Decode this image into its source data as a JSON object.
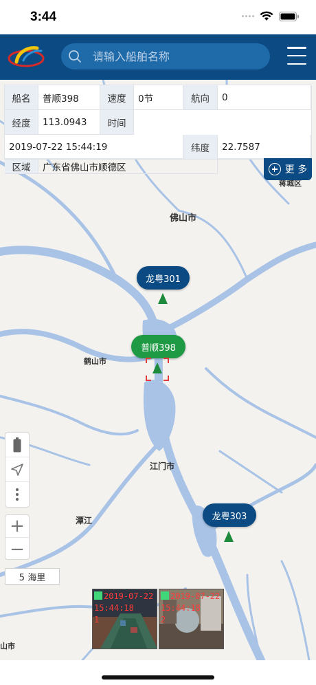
{
  "status_bar": {
    "time": "3:44"
  },
  "header": {
    "search_placeholder": "请输入船舶名称",
    "search_icon": "search-icon",
    "menu_icon": "hamburger-menu-icon"
  },
  "info": {
    "name_label": "船名",
    "name_value": "普顺398",
    "speed_label": "速度",
    "speed_value": "0节",
    "heading_label": "航向",
    "heading_value": "0",
    "lon_label": "经度",
    "lon_value": "113.0943",
    "time_label": "时间",
    "time_value": "2019-07-22 15:44:19",
    "lat_label": "纬度",
    "lat_value": "22.7587",
    "region_label": "区域",
    "region_value": "广东省佛山市顺德区"
  },
  "more_button": {
    "label": "更 多"
  },
  "map": {
    "cities": {
      "foshan": "佛山市",
      "heshan": "鹤山市",
      "jiangmen": "江门市",
      "tanjiang": "潭江",
      "fragment_right": "蒋城区",
      "fragment_bottom": "山市"
    },
    "ships": [
      {
        "name": "龙粤301",
        "color": "#0b4a82"
      },
      {
        "name": "普顺398",
        "color": "#1e9a45",
        "selected": true
      },
      {
        "name": "龙粤303",
        "color": "#0b4a82"
      }
    ],
    "scale_label": "5 海里"
  },
  "tools": {
    "battery_icon": "battery-icon",
    "locate_icon": "navigation-arrow-icon",
    "more_icon": "vertical-dots-icon",
    "zoom_in": "+",
    "zoom_out": "−"
  },
  "thumbnails": [
    {
      "date": "2019-07-22",
      "time": "15:44:18",
      "index": "1"
    },
    {
      "date": "2019-07-22",
      "time": "15:44:18",
      "index": "2"
    }
  ]
}
